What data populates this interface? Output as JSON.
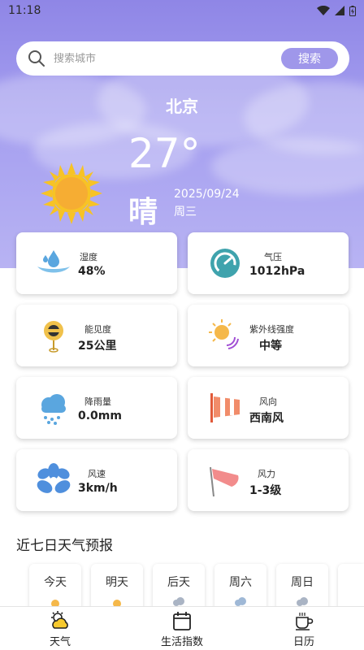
{
  "status": {
    "time": "11:18"
  },
  "search": {
    "placeholder": "搜索城市",
    "button_label": "搜索"
  },
  "current": {
    "city": "北京",
    "temperature": "27°",
    "condition": "晴",
    "date": "2025/09/24",
    "weekday": "周三",
    "icon": "sun-icon"
  },
  "cards": [
    {
      "label": "湿度",
      "value": "48%",
      "icon": "humidity-icon"
    },
    {
      "label": "气压",
      "value": "1012hPa",
      "icon": "pressure-gauge-icon"
    },
    {
      "label": "能见度",
      "value": "25公里",
      "icon": "visibility-icon"
    },
    {
      "label": "紫外线强度",
      "value": "中等",
      "icon": "uv-icon"
    },
    {
      "label": "降雨量",
      "value": "0.0mm",
      "icon": "rain-cloud-icon"
    },
    {
      "label": "风向",
      "value": "西南风",
      "icon": "windsock-icon"
    },
    {
      "label": "风速",
      "value": "3km/h",
      "icon": "fan-icon"
    },
    {
      "label": "风力",
      "value": "1-3级",
      "icon": "wind-flag-icon"
    }
  ],
  "forecast": {
    "title": "近七日天气预报",
    "days": [
      {
        "label": "今天",
        "icon": "sun-icon"
      },
      {
        "label": "明天",
        "icon": "sun-icon"
      },
      {
        "label": "后天",
        "icon": "cloud-icon"
      },
      {
        "label": "周六",
        "icon": "cloud-icon"
      },
      {
        "label": "周日",
        "icon": "cloud-icon"
      }
    ]
  },
  "nav": [
    {
      "label": "天气",
      "icon": "weather-icon"
    },
    {
      "label": "生活指数",
      "icon": "calendar-icon"
    },
    {
      "label": "日历",
      "icon": "coffee-icon"
    }
  ],
  "colors": {
    "accent": "#9f97ea",
    "hero_top": "#8f86e6",
    "sun": "#f7b733"
  }
}
